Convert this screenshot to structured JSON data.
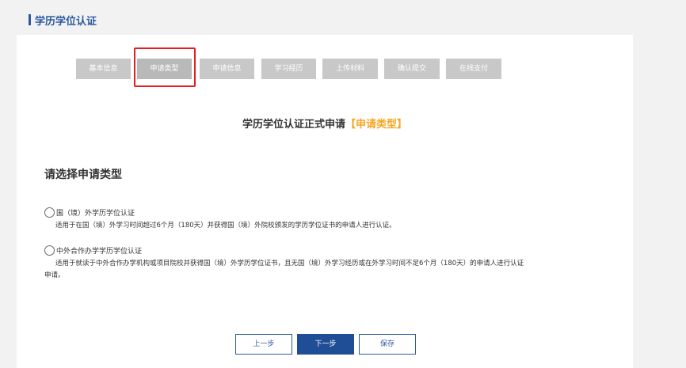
{
  "header": {
    "title": "学历学位认证"
  },
  "steps": [
    {
      "label": "基本信息",
      "active": false
    },
    {
      "label": "申请类型",
      "active": true
    },
    {
      "label": "申请信息",
      "active": false
    },
    {
      "label": "学习经历",
      "active": false
    },
    {
      "label": "上传材料",
      "active": false
    },
    {
      "label": "确认提交",
      "active": false
    },
    {
      "label": "在线支付",
      "active": false
    }
  ],
  "form": {
    "title": "学历学位认证正式申请",
    "title_tag": "【申请类型】",
    "section_heading": "请选择申请类型",
    "options": [
      {
        "label": "国（境）外学历学位认证",
        "description": "适用于在国（境）外学习时间超过6个月（180天）并获得国（境）外院校颁发的学历学位证书的申请人进行认证。",
        "description_cont": ""
      },
      {
        "label": "中外合作办学学历学位认证",
        "description": "适用于就读于中外合作办学机构或项目院校并获得国（境）外学历学位证书，且无国（境）外学习经历或在外学习时间不足6个月（180天）的申请人进行认证",
        "description_cont": "申请。"
      }
    ]
  },
  "buttons": {
    "prev": "上一步",
    "next": "下一步",
    "save": "保存"
  },
  "colors": {
    "brand": "#2c5aa0",
    "accent": "#f5a623",
    "highlight": "#e02020",
    "step_bg": "#c8c8c8"
  }
}
